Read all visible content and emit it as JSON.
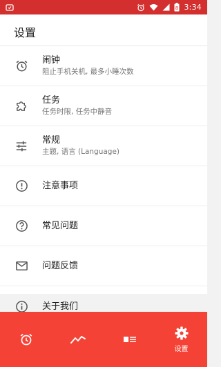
{
  "status_bar": {
    "time": "3:34",
    "battery_level": "8",
    "icons": [
      "alarm-small-icon",
      "alarm-clock-icon",
      "wifi-icon",
      "signal-icon",
      "battery-icon"
    ]
  },
  "page": {
    "title": "设置"
  },
  "settings": [
    {
      "icon": "alarm-clock-icon",
      "label": "闹钟",
      "sub": "阻止手机关机, 最多小睡次数"
    },
    {
      "icon": "puzzle-icon",
      "label": "任务",
      "sub": "任务时限, 任务中静音"
    },
    {
      "icon": "sliders-icon",
      "label": "常规",
      "sub": "主题, 语言 (Language)"
    },
    {
      "icon": "alert-circle-icon",
      "label": "注意事项",
      "sub": ""
    },
    {
      "icon": "help-circle-icon",
      "label": "常见问题",
      "sub": ""
    },
    {
      "icon": "mail-icon",
      "label": "问题反馈",
      "sub": ""
    },
    {
      "icon": "info-circle-icon",
      "label": "关于我们",
      "sub": ""
    }
  ],
  "bottom_nav": {
    "items": [
      {
        "icon": "alarm-clock-icon",
        "label": ""
      },
      {
        "icon": "trend-icon",
        "label": ""
      },
      {
        "icon": "card-list-icon",
        "label": ""
      },
      {
        "icon": "gear-icon",
        "label": "设置",
        "active": true
      }
    ]
  },
  "colors": {
    "status_bar": "#d32f2f",
    "bottom_nav": "#f44336",
    "background": "#f2f2f2",
    "text_primary": "#212121",
    "text_secondary": "#757575"
  }
}
